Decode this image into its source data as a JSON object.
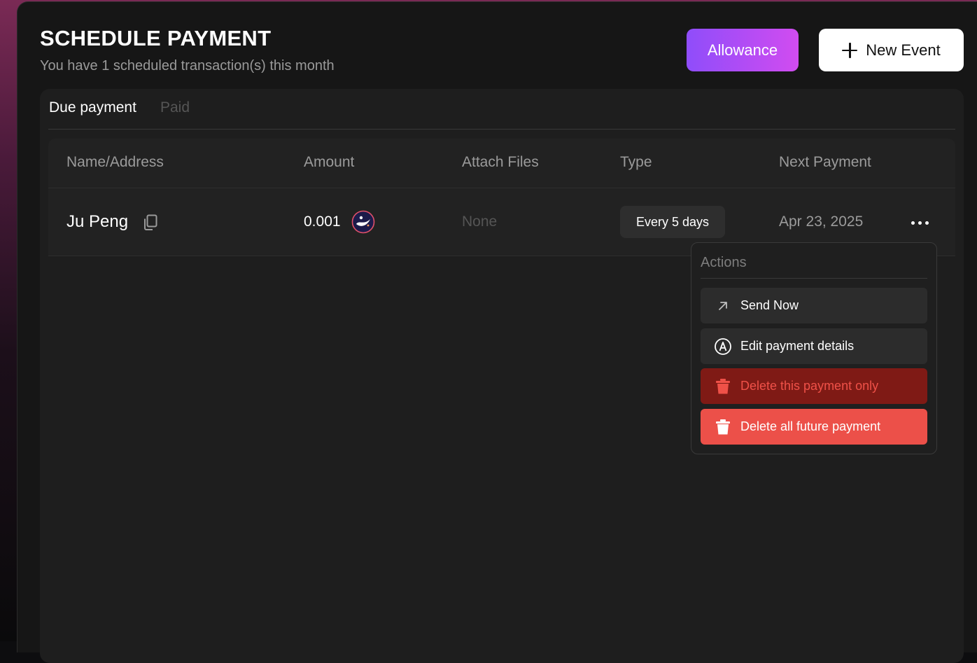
{
  "header": {
    "title": "SCHEDULE PAYMENT",
    "subtitle": "You have 1 scheduled transaction(s) this month",
    "allowance_label": "Allowance",
    "new_event_label": "New Event"
  },
  "tabs": [
    {
      "label": "Due payment",
      "active": true
    },
    {
      "label": "Paid",
      "active": false
    }
  ],
  "table": {
    "columns": [
      "Name/Address",
      "Amount",
      "Attach Files",
      "Type",
      "Next Payment"
    ],
    "rows": [
      {
        "name": "Ju Peng",
        "amount": "0.001",
        "attach_files": "None",
        "type": "Every 5 days",
        "next_payment": "Apr 23, 2025"
      }
    ]
  },
  "actions_menu": {
    "title": "Actions",
    "items": [
      {
        "label": "Send Now",
        "icon": "arrow-up-right-icon"
      },
      {
        "label": "Edit payment details",
        "icon": "edit-circle-icon"
      },
      {
        "label": "Delete this payment only",
        "icon": "trash-icon"
      },
      {
        "label": "Delete all future payment",
        "icon": "trash-icon"
      }
    ]
  },
  "colors": {
    "accent_gradient_start": "#8f4dfa",
    "accent_gradient_end": "#d14cf0",
    "danger": "#ec5049",
    "danger_dark": "#7f1a15"
  }
}
